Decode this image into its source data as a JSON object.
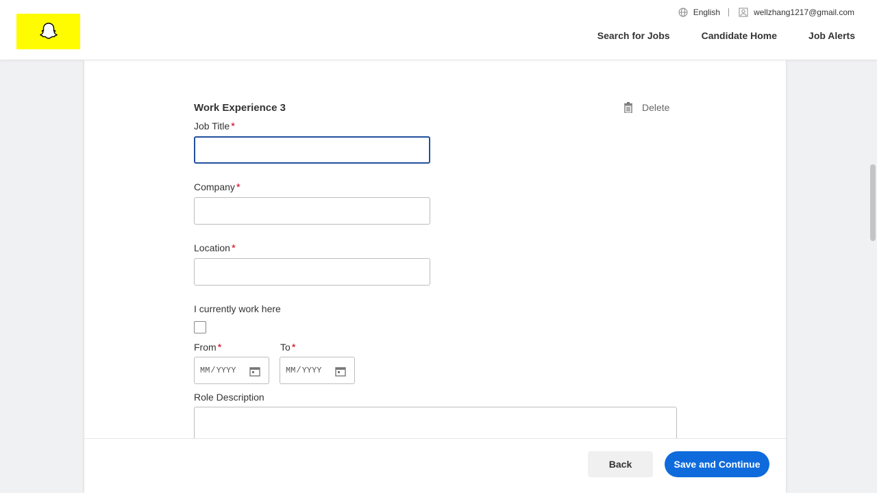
{
  "header": {
    "language": "English",
    "user_email": "wellzhang1217@gmail.com",
    "nav": {
      "search_jobs": "Search for Jobs",
      "candidate_home": "Candidate Home",
      "job_alerts": "Job Alerts"
    }
  },
  "form": {
    "section_title": "Work Experience 3",
    "delete_label": "Delete",
    "fields": {
      "job_title": {
        "label": "Job Title",
        "value": "",
        "required_mark": "*"
      },
      "company": {
        "label": "Company",
        "value": "",
        "required_mark": "*"
      },
      "location": {
        "label": "Location",
        "value": "",
        "required_mark": "*"
      },
      "currently_work_here": {
        "label": "I currently work here",
        "checked": false
      },
      "from": {
        "label": "From",
        "required_mark": "*",
        "month_placeholder": "MM",
        "year_placeholder": "YYYY",
        "separator": "/"
      },
      "to": {
        "label": "To",
        "required_mark": "*",
        "month_placeholder": "MM",
        "year_placeholder": "YYYY",
        "separator": "/"
      },
      "role_description": {
        "label": "Role Description",
        "value": ""
      }
    }
  },
  "footer": {
    "back_label": "Back",
    "save_label": "Save and Continue"
  },
  "colors": {
    "brand_yellow": "#fffc00",
    "primary_blue": "#0f6bdc",
    "required_red": "#d0021b"
  }
}
